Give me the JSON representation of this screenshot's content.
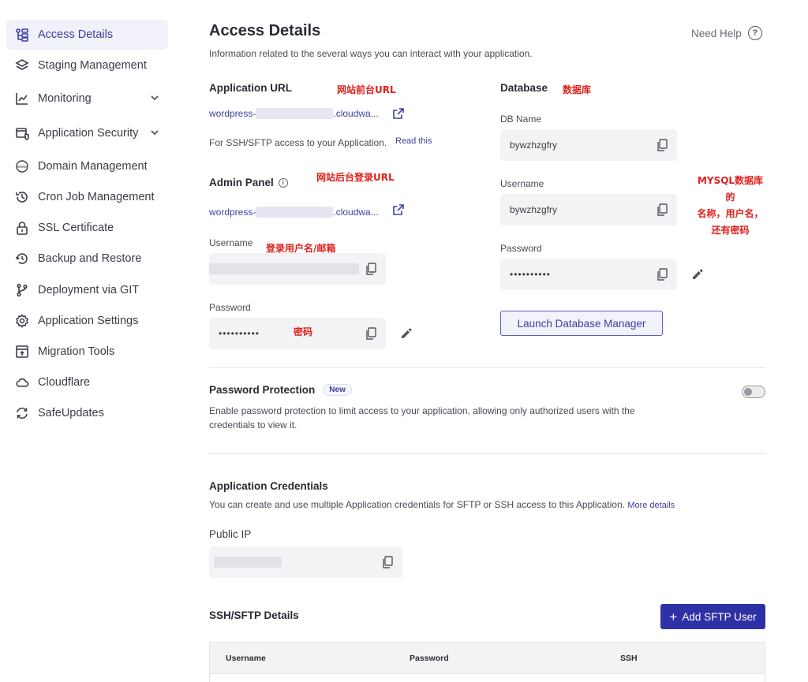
{
  "sidebar": {
    "items": [
      {
        "label": "Access Details",
        "icon": "access-details-icon"
      },
      {
        "label": "Staging Management",
        "icon": "layers-icon"
      },
      {
        "label": "Monitoring",
        "icon": "chart-line-icon"
      },
      {
        "label": "Application Security",
        "icon": "security-window-icon"
      },
      {
        "label": "Domain Management",
        "icon": "www-globe-icon"
      },
      {
        "label": "Cron Job Management",
        "icon": "history-clock-icon"
      },
      {
        "label": "SSL Certificate",
        "icon": "lock-icon"
      },
      {
        "label": "Backup and Restore",
        "icon": "backup-restore-icon"
      },
      {
        "label": "Deployment via GIT",
        "icon": "git-branch-icon"
      },
      {
        "label": "Application Settings",
        "icon": "gear-icon"
      },
      {
        "label": "Migration Tools",
        "icon": "migration-icon"
      },
      {
        "label": "Cloudflare",
        "icon": "cloud-icon"
      },
      {
        "label": "SafeUpdates",
        "icon": "refresh-icon"
      }
    ]
  },
  "header": {
    "title": "Access Details",
    "subtitle": "Information related to the several ways you can interact with your application.",
    "help_label": "Need Help"
  },
  "app_url": {
    "title": "Application URL",
    "annotation": "网站前台URL",
    "prefix": "wordpress-",
    "suffix": ".cloudwa...",
    "ssh_note": "For SSH/SFTP access to your Application.",
    "read_this": "Read this"
  },
  "admin_panel": {
    "title": "Admin Panel",
    "annotation": "网站后台登录URL",
    "prefix": "wordpress-",
    "suffix": ".cloudwa...",
    "username_label": "Username",
    "username_annotation": "登录用户名/邮箱",
    "password_label": "Password",
    "password_value": "••••••••••",
    "password_annotation": "密码"
  },
  "database": {
    "title": "Database",
    "annotation": "数据库",
    "db_name_label": "DB Name",
    "db_name_value": "bywzhzgfry",
    "username_label": "Username",
    "username_value": "bywzhzgfry",
    "password_label": "Password",
    "password_value": "••••••••••",
    "side_annotation_1": "MYSQL数据库的",
    "side_annotation_2": "名称，用户名，",
    "side_annotation_3": "还有密码",
    "launch_label": "Launch Database Manager"
  },
  "password_protection": {
    "title": "Password Protection",
    "badge": "New",
    "desc_1": "Enable password protection to limit access to your application, allowing only authorized users with the",
    "desc_2": "credentials to view it.",
    "enabled": false
  },
  "credentials": {
    "title": "Application Credentials",
    "desc": "You can create and use multiple Application credentials for SFTP or SSH access to this Application.",
    "more_details": "More details",
    "public_ip_label": "Public IP"
  },
  "sftp": {
    "title": "SSH/SFTP Details",
    "add_label": "Add SFTP User",
    "columns": [
      "Username",
      "Password",
      "SSH"
    ]
  },
  "colors": {
    "accent": "#3b3fa0",
    "primary_button": "#2e31a6",
    "annotation_red": "#e0201c"
  }
}
